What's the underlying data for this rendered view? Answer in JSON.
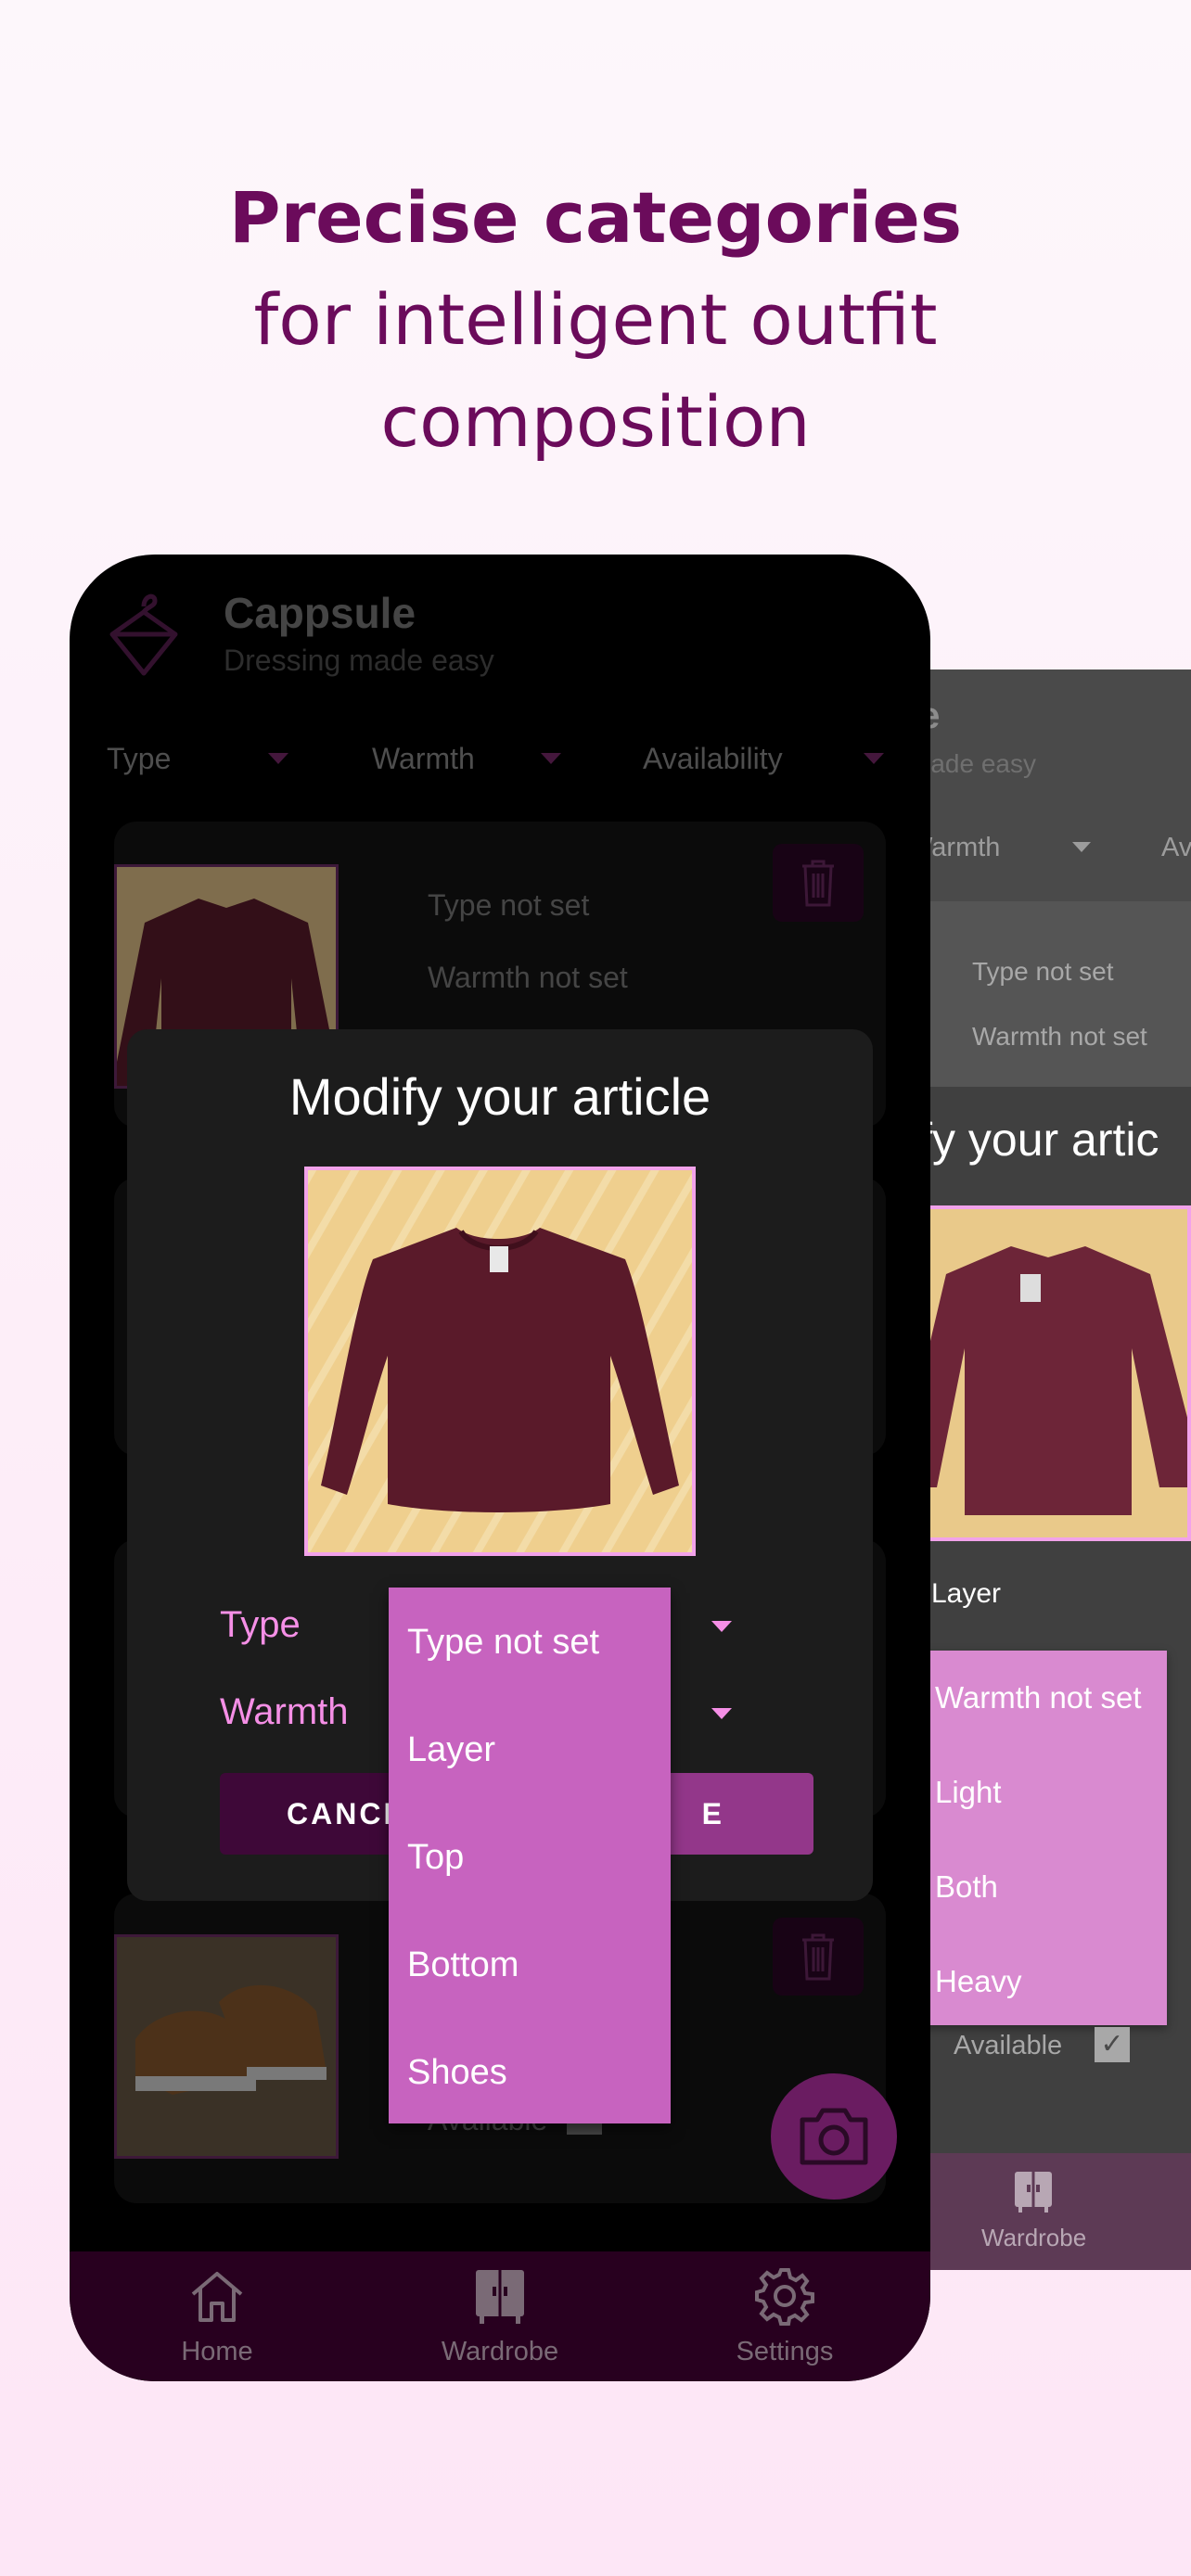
{
  "headline": {
    "line1": "Precise categories",
    "line2": "for intelligent outfit",
    "line3": "composition"
  },
  "app": {
    "title": "Cappsule",
    "subtitle": "Dressing made easy"
  },
  "filters": {
    "type": "Type",
    "warmth": "Warmth",
    "availability": "Availability"
  },
  "card1": {
    "type": "Type not set",
    "warmth": "Warmth not set"
  },
  "card_bottom": {
    "available": "Available"
  },
  "modal": {
    "title": "Modify your article",
    "type_label": "Type",
    "warmth_label": "Warmth",
    "cancel_label": "CANCEL",
    "save_label": "SAVE",
    "cancel_visible": "CANCE",
    "save_visible": "E"
  },
  "type_dropdown": {
    "options": [
      "Type not set",
      "Layer",
      "Top",
      "Bottom",
      "Shoes"
    ]
  },
  "nav": {
    "home": "Home",
    "wardrobe": "Wardrobe",
    "settings": "Settings"
  },
  "back_phone": {
    "title_fragment": "le",
    "subtitle_fragment": "made easy",
    "filter_warmth": "Warmth",
    "filter_av_fragment": "Av",
    "card_type": "Type not set",
    "card_warmth": "Warmth not set",
    "modal_title_fragment": "ify your artic",
    "type_value": "Layer",
    "warmth_options": [
      "Warmth not set",
      "Light",
      "Both",
      "Heavy"
    ],
    "available": "Available",
    "nav_wardrobe": "Wardrobe"
  },
  "colors": {
    "headline": "#6b0b5b",
    "accent_pink": "#f58fe6",
    "dropdown_bg": "#c763bf",
    "nav_bg": "#28001f"
  }
}
